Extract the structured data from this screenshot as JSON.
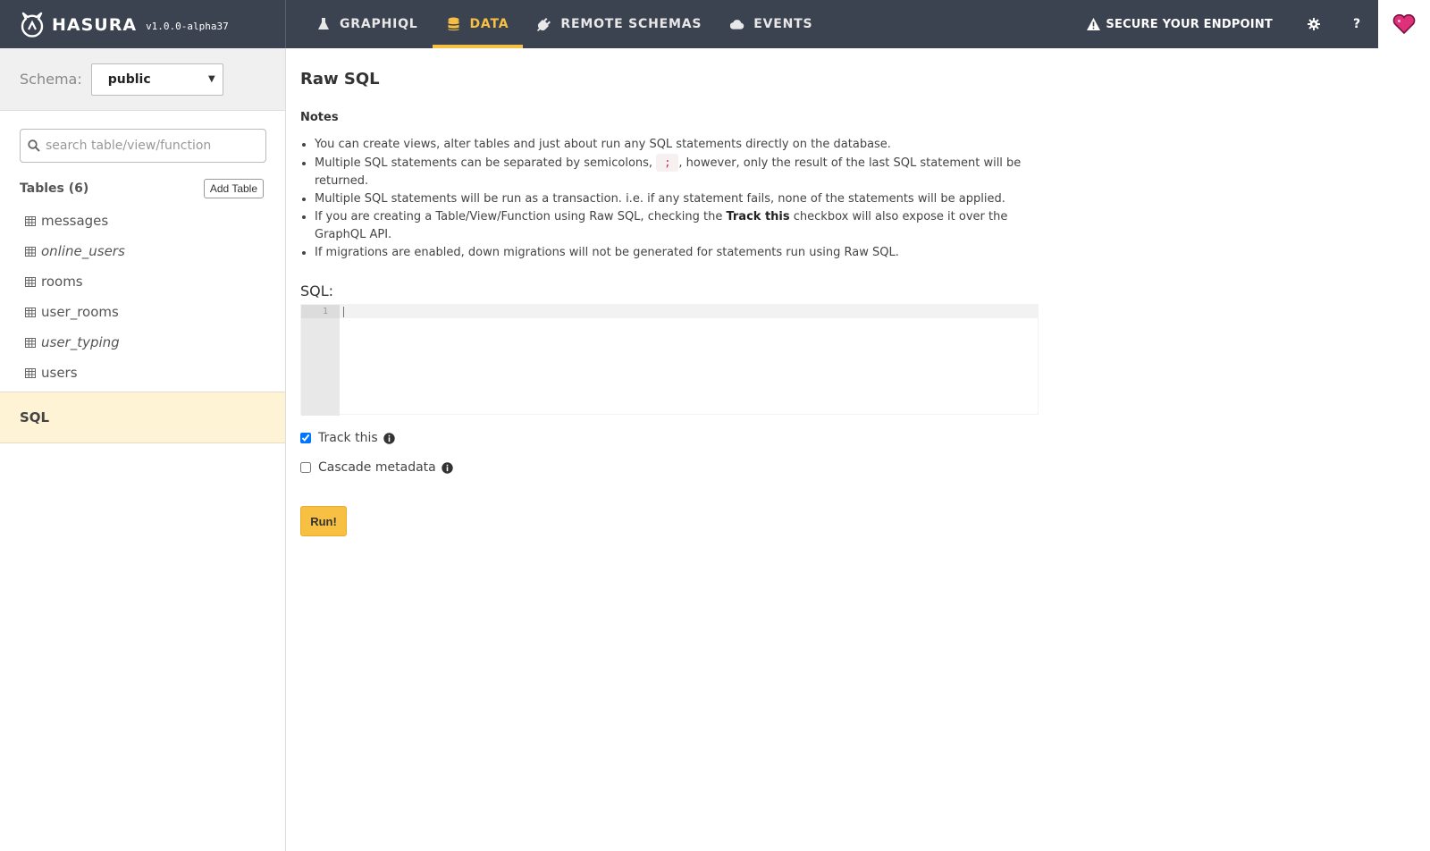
{
  "header": {
    "logo_text": "HASURA",
    "version": "v1.0.0-alpha37",
    "tabs": [
      {
        "label": "GRAPHIQL",
        "icon": "flask-icon",
        "active": false
      },
      {
        "label": "DATA",
        "icon": "database-icon",
        "active": true
      },
      {
        "label": "REMOTE SCHEMAS",
        "icon": "plug-icon",
        "active": false
      },
      {
        "label": "EVENTS",
        "icon": "cloud-icon",
        "active": false
      }
    ],
    "secure_label": "SECURE YOUR ENDPOINT",
    "help_label": "?",
    "accent_color": "#f8c042",
    "nav_bg": "#3c4350",
    "heart_color": "#e0307a"
  },
  "sidebar": {
    "schema_label": "Schema:",
    "schema_value": "public",
    "search_placeholder": "search table/view/function",
    "tables_title": "Tables (6)",
    "add_table_label": "Add Table",
    "tables": [
      {
        "name": "messages",
        "italic": false
      },
      {
        "name": "online_users",
        "italic": true
      },
      {
        "name": "rooms",
        "italic": false
      },
      {
        "name": "user_rooms",
        "italic": false
      },
      {
        "name": "user_typing",
        "italic": true
      },
      {
        "name": "users",
        "italic": false
      }
    ],
    "sql_label": "SQL",
    "sql_bg": "#fff3d5"
  },
  "main": {
    "title": "Raw SQL",
    "notes_title": "Notes",
    "notes": {
      "n1": "You can create views, alter tables and just about run any SQL statements directly on the database.",
      "n2_before": "Multiple SQL statements can be separated by semicolons, ",
      "n2_code": ";",
      "n2_after": ", however, only the result of the last SQL statement will be returned.",
      "n3": "Multiple SQL statements will be run as a transaction. i.e. if any statement fails, none of the statements will be applied.",
      "n4_before": "If you are creating a Table/View/Function using Raw SQL, checking the ",
      "n4_bold": "Track this",
      "n4_after": " checkbox will also expose it over the GraphQL API.",
      "n5": "If migrations are enabled, down migrations will not be generated for statements run using Raw SQL."
    },
    "sql_label": "SQL:",
    "editor_line": "1",
    "editor_value": "",
    "track_label": "Track this",
    "track_checked": true,
    "cascade_label": "Cascade metadata",
    "cascade_checked": false,
    "run_label": "Run!"
  }
}
